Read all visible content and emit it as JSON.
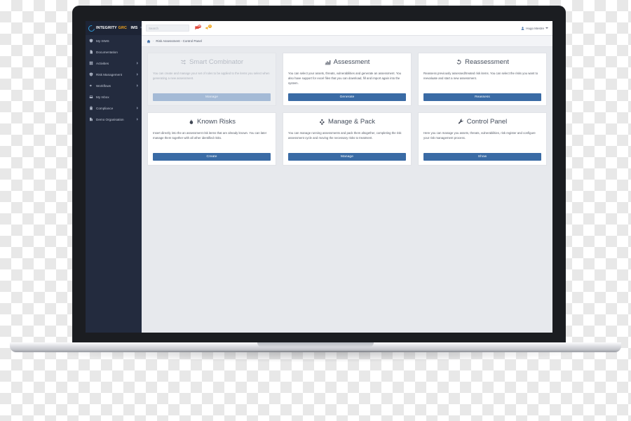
{
  "brand": {
    "name_part1": "INTEGRITY",
    "name_part2": "GRC",
    "name_part3": "IMS",
    "collapse_label": "×",
    "accent_color": "#f5a61e",
    "mark_color": "#2f9bd8"
  },
  "sidebar": {
    "background_color": "#232b3e",
    "items": [
      {
        "label": "My ISMS",
        "icon": "shield-icon",
        "has_submenu": false
      },
      {
        "label": "Documentation",
        "icon": "document-icon",
        "has_submenu": false
      },
      {
        "label": "Activities",
        "icon": "grid-icon",
        "has_submenu": true
      },
      {
        "label": "Risk Management",
        "icon": "shield-alert-icon",
        "has_submenu": true
      },
      {
        "label": "Workflows",
        "icon": "megaphone-icon",
        "has_submenu": true
      },
      {
        "label": "My Inbox",
        "icon": "inbox-icon",
        "has_submenu": false
      },
      {
        "label": "Compliance",
        "icon": "clipboard-icon",
        "has_submenu": true
      },
      {
        "label": "Demo Organisation",
        "icon": "building-icon",
        "has_submenu": true
      }
    ]
  },
  "topbar": {
    "search": {
      "value": "",
      "placeholder": "Search"
    },
    "notifications": [
      {
        "name": "messages",
        "icon": "speech-bubble-icon",
        "count": "20",
        "color": "#e0483c"
      },
      {
        "name": "alerts",
        "icon": "bullhorn-icon",
        "count": "1",
        "color": "#f2a922"
      }
    ],
    "user": {
      "name": "Hugo Mestre",
      "icon": "user-icon",
      "caret": "▾"
    }
  },
  "breadcrumb": {
    "home_icon": "home-icon",
    "separator": "-",
    "text": "Risk Assessment - Control Panel"
  },
  "cards": [
    {
      "title": "Smart Combinator",
      "icon": "shuffle-icon",
      "description": "You can create and manage your set of rules to be applied to the items you select when generating a new assessment.",
      "button_label": "Manage",
      "disabled": true,
      "button_color": "#a4bad6"
    },
    {
      "title": "Assessment",
      "icon": "bar-chart-icon",
      "description": "You can select your assets, threats, vulnerabilities and generate an assessment. You also have support for excel files that you can download, fill and import again into the system.",
      "button_label": "Generate",
      "disabled": false,
      "button_color": "#3a6ba5"
    },
    {
      "title": "Reassessment",
      "icon": "refresh-icon",
      "description": "Reassess previously assessed/treated risk items. You can select the risks you want to reevaluate and start a new assessment.",
      "button_label": "Reassess",
      "disabled": false,
      "button_color": "#3a6ba5"
    },
    {
      "title": "Known Risks",
      "icon": "flame-icon",
      "description": "Insert directly into the an assessment risk items that are already known. You can later manage them together with all other identified risks.",
      "button_label": "Create",
      "disabled": false,
      "button_color": "#3a6ba5"
    },
    {
      "title": "Manage & Pack",
      "icon": "boxes-icon",
      "description": "You can manage running assessments and pack them altogether, completing the risk assessment cycle and moving the necessary risks to treatment.",
      "button_label": "Manage",
      "disabled": false,
      "button_color": "#3a6ba5"
    },
    {
      "title": "Control Panel",
      "icon": "wrench-icon",
      "description": "Here you can manage you assets, threats, vulnerabilities, risk register and configure your risk management process.",
      "button_label": "Show",
      "disabled": false,
      "button_color": "#3a6ba5"
    }
  ]
}
